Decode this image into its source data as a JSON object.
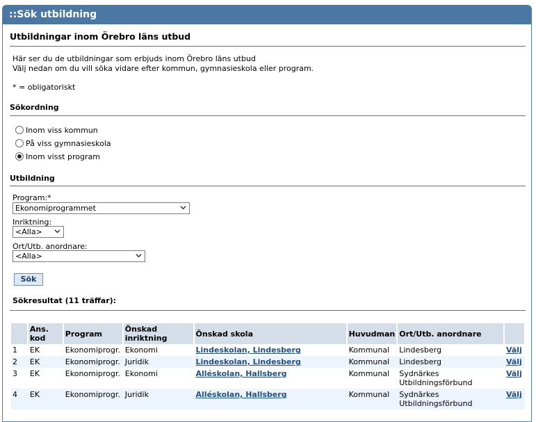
{
  "header": {
    "title": "::Sök utbildning"
  },
  "page_title": "Utbildningar inom Örebro läns utbud",
  "intro": {
    "line1": "Här ser du de utbildningar som erbjuds inom Örebro läns utbud",
    "line2": "Välj nedan om du vill söka vidare efter kommun, gymnasieskola eller program.",
    "required_note": "* = obligatoriskt"
  },
  "sort": {
    "heading": "Sökordning",
    "options": [
      {
        "label": "Inom viss kommun",
        "checked": false
      },
      {
        "label": "På viss gymnasieskola",
        "checked": false
      },
      {
        "label": "Inom visst program",
        "checked": true
      }
    ]
  },
  "education": {
    "heading": "Utbildning",
    "program_label": "Program:*",
    "program_value": "Ekonomiprogrammet",
    "direction_label": "Inriktning:",
    "direction_value": "<Alla>",
    "location_label": "Ort/Utb. anordnare:",
    "location_value": "<Alla>",
    "search_button": "Sök"
  },
  "results": {
    "heading": "Sökresultat (11 träffar):",
    "columns": [
      "",
      "Ans. kod",
      "Program",
      "Önskad inriktning",
      "Önskad skola",
      "Huvudman",
      "Ort/Utb. anordnare",
      ""
    ],
    "rows": [
      {
        "num": "1",
        "code": "EK",
        "program": "Ekonomiprogr.",
        "direction": "Ekonomi",
        "school": "Lindeskolan, Lindesberg",
        "principal": "Kommunal",
        "location": "Lindesberg",
        "action": "Välj"
      },
      {
        "num": "2",
        "code": "EK",
        "program": "Ekonomiprogr.",
        "direction": "Juridik",
        "school": "Lindeskolan, Lindesberg",
        "principal": "Kommunal",
        "location": "Lindesberg",
        "action": "Välj"
      },
      {
        "num": "3",
        "code": "EK",
        "program": "Ekonomiprogr.",
        "direction": "Ekonomi",
        "school": "Alléskolan, Hallsberg",
        "principal": "Kommunal",
        "location": "Sydnärkes Utbildningsförbund",
        "action": "Välj"
      },
      {
        "num": "4",
        "code": "EK",
        "program": "Ekonomiprogr.",
        "direction": "Juridik",
        "school": "Alléskolan, Hallsberg",
        "principal": "Kommunal",
        "location": "Sydnärkes Utbildningsförbund",
        "action": "Välj"
      }
    ]
  }
}
